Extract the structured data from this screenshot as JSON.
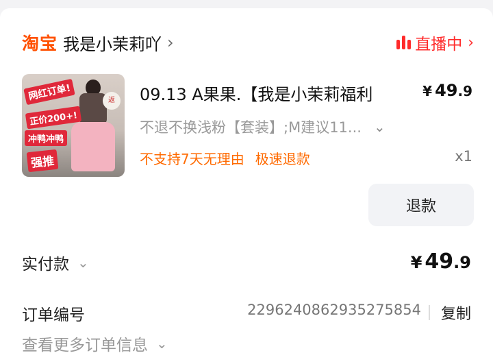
{
  "shop": {
    "brand": "淘宝",
    "name": "我是小茉莉吖",
    "chevron": "›",
    "live_label": "直播中",
    "live_chevron": "›"
  },
  "item": {
    "thumb_tags": [
      "网红订单!",
      "正价200+!",
      "冲鸭冲鸭",
      "强推"
    ],
    "thumb_badge": "返",
    "title": "09.13 A果果.【我是小茉莉福利",
    "price_currency": "¥",
    "price_int": "49",
    "price_dec": ".9",
    "spec": "不退不换浅粉【套装】;M建议11...",
    "spec_chevron": "⌄",
    "policies": [
      "不支持7天无理由",
      "极速退款"
    ],
    "quantity": "x1",
    "refund_button": "退款"
  },
  "payment": {
    "label": "实付款",
    "chevron": "⌄",
    "currency": "¥",
    "int": "49",
    "dec": ".9"
  },
  "order": {
    "label": "订单编号",
    "number": "2296240862935275854",
    "copy_label": "复制",
    "more_label": "查看更多订单信息",
    "more_chevron": "⌄"
  },
  "colors": {
    "brand": "#ff5000",
    "live": "#ff2b2b",
    "policy": "#ff6a00"
  }
}
